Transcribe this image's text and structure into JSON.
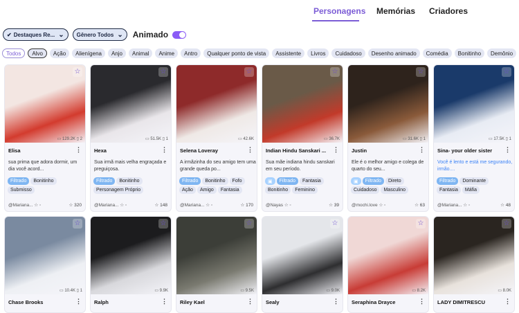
{
  "nav": {
    "tabs": [
      "Personagens",
      "Memórias",
      "Criadores"
    ]
  },
  "filters": {
    "featured": "Destaques Re...",
    "gender": "Gênero Todos",
    "animated_label": "Animado"
  },
  "tags": [
    "Todos",
    "Alvo",
    "Ação",
    "Alienígena",
    "Anjo",
    "Animal",
    "Anime",
    "Antro",
    "Qualquer ponto de vista",
    "Assistente",
    "Livros",
    "Cuidadoso",
    "Desenho animado",
    "Comédia",
    "Bonitinho",
    "Demônio",
    "De"
  ],
  "cards": [
    {
      "name": "Elisa",
      "stat": "129.2K",
      "count": "2",
      "desc": "sua prima que adora dormir, um dia você acord...",
      "tags": [
        "Filtrado",
        "Bonitinho",
        "Submisso"
      ],
      "author": "@Mariana...",
      "likes": "320",
      "colors": [
        "#f3e6e2",
        "#d33b2e"
      ]
    },
    {
      "name": "Hexa",
      "stat": "51.5K",
      "count": "1",
      "desc": "Sua irmã mais velha engraçada e preguiçosa.",
      "tags": [
        "Filtrado",
        "Bonitinho",
        "Personagem Próprio"
      ],
      "author": "@Mariana...",
      "likes": "148",
      "colors": [
        "#2a2a2e",
        "#e9e6ea"
      ]
    },
    {
      "name": "Selena Loveray",
      "stat": "42.6K",
      "count": "",
      "desc": "A irmãzinha do seu amigo tem uma grande queda po...",
      "tags": [
        "Filtrado",
        "Bonitinho",
        "Fofo",
        "Ação",
        "Amigo",
        "Fantasia"
      ],
      "author": "@Mariana...",
      "likes": "170",
      "colors": [
        "#8e2a2a",
        "#efe9e6"
      ]
    },
    {
      "name": "Indian Hindu Sanskari ...",
      "stat": "36.7K",
      "count": "",
      "desc": "Sua mãe indiana hindu sanskari em seu período.",
      "tags": [
        "Filtrado",
        "Fantasia",
        "Bonitinho",
        "Feminino"
      ],
      "author": "@Nayas",
      "likes": "39",
      "colors": [
        "#6a5a48",
        "#c23a2a"
      ]
    },
    {
      "name": "Justin",
      "stat": "31.6K",
      "count": "1",
      "desc": "Ele é o melhor amigo e colega de quarto do seu...",
      "tags": [
        "Filtrado",
        "Direto",
        "Cuidadoso",
        "Masculino"
      ],
      "author": "@mochi.love",
      "likes": "63",
      "colors": [
        "#2e231c",
        "#8a5a3a"
      ]
    },
    {
      "name": "Sina- your older sister",
      "stat": "17.5K",
      "count": "1",
      "desc": "Você é lento e está me segurando, irmão....",
      "tags": [
        "Filtrado",
        "Dominante",
        "Fantasia",
        "Máfia"
      ],
      "author": "@Mariana...",
      "likes": "48",
      "colors": [
        "#1a3a6a",
        "#e8ecf4"
      ]
    },
    {
      "name": "Chase Brooks",
      "stat": "10.4K",
      "count": "1",
      "colors": [
        "#7a8aa0",
        "#eef0f4"
      ]
    },
    {
      "name": "Ralph",
      "stat": "9.9K",
      "count": "",
      "colors": [
        "#1c1c1e",
        "#d8d8dc"
      ]
    },
    {
      "name": "Riley Kael",
      "stat": "9.5K",
      "count": "",
      "colors": [
        "#3c3e38",
        "#7a7a70"
      ]
    },
    {
      "name": "Sealy",
      "stat": "9.0K",
      "count": "",
      "colors": [
        "#e4e6ea",
        "#2e2e30"
      ]
    },
    {
      "name": "Seraphina Drayce",
      "stat": "8.2K",
      "count": "",
      "colors": [
        "#f0d8d6",
        "#c83c36"
      ]
    },
    {
      "name": "LADY DIMITRESCU",
      "stat": "8.0K",
      "count": "",
      "colors": [
        "#2a2520",
        "#e8e2dc"
      ]
    }
  ]
}
